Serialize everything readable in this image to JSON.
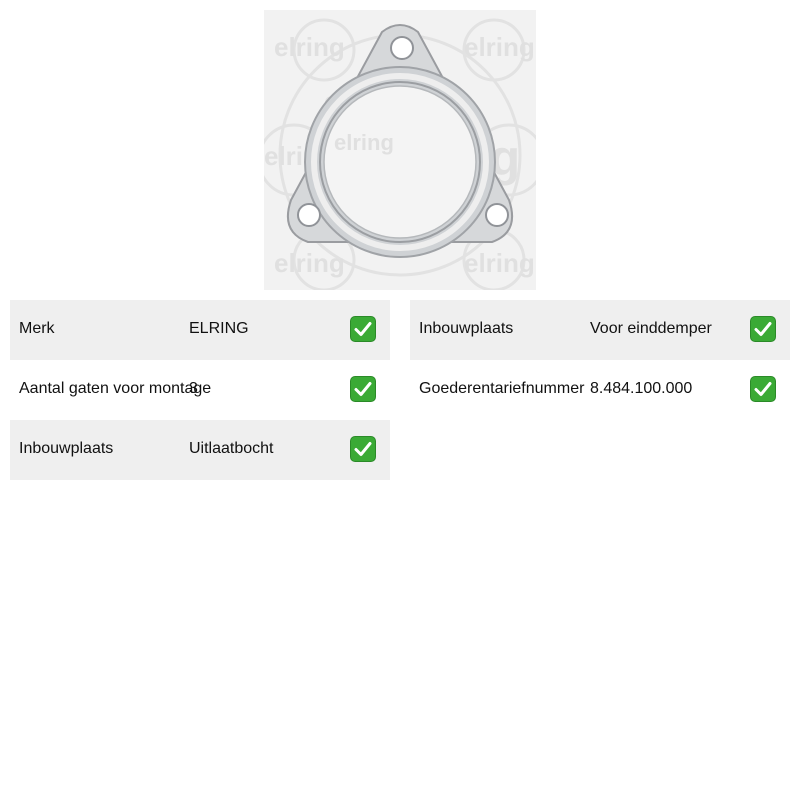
{
  "product_image": {
    "alt": "elring gasket",
    "watermark": "elring",
    "icon": "gasket-image"
  },
  "specs_left": [
    {
      "label": "Merk",
      "value": "ELRING",
      "check": "check-icon"
    },
    {
      "label": "Aantal gaten voor montage",
      "value": "3",
      "check": "check-icon"
    },
    {
      "label": "Inbouwplaats",
      "value": "Uitlaatbocht",
      "check": "check-icon"
    }
  ],
  "specs_right": [
    {
      "label": "Inbouwplaats",
      "value": "Voor einddemper",
      "check": "check-icon"
    },
    {
      "label": "Goederentariefnummer",
      "value": "8.484.100.000",
      "check": "check-icon"
    }
  ],
  "colors": {
    "row_shade": "#efefef",
    "check_green": "#3aaa35"
  }
}
